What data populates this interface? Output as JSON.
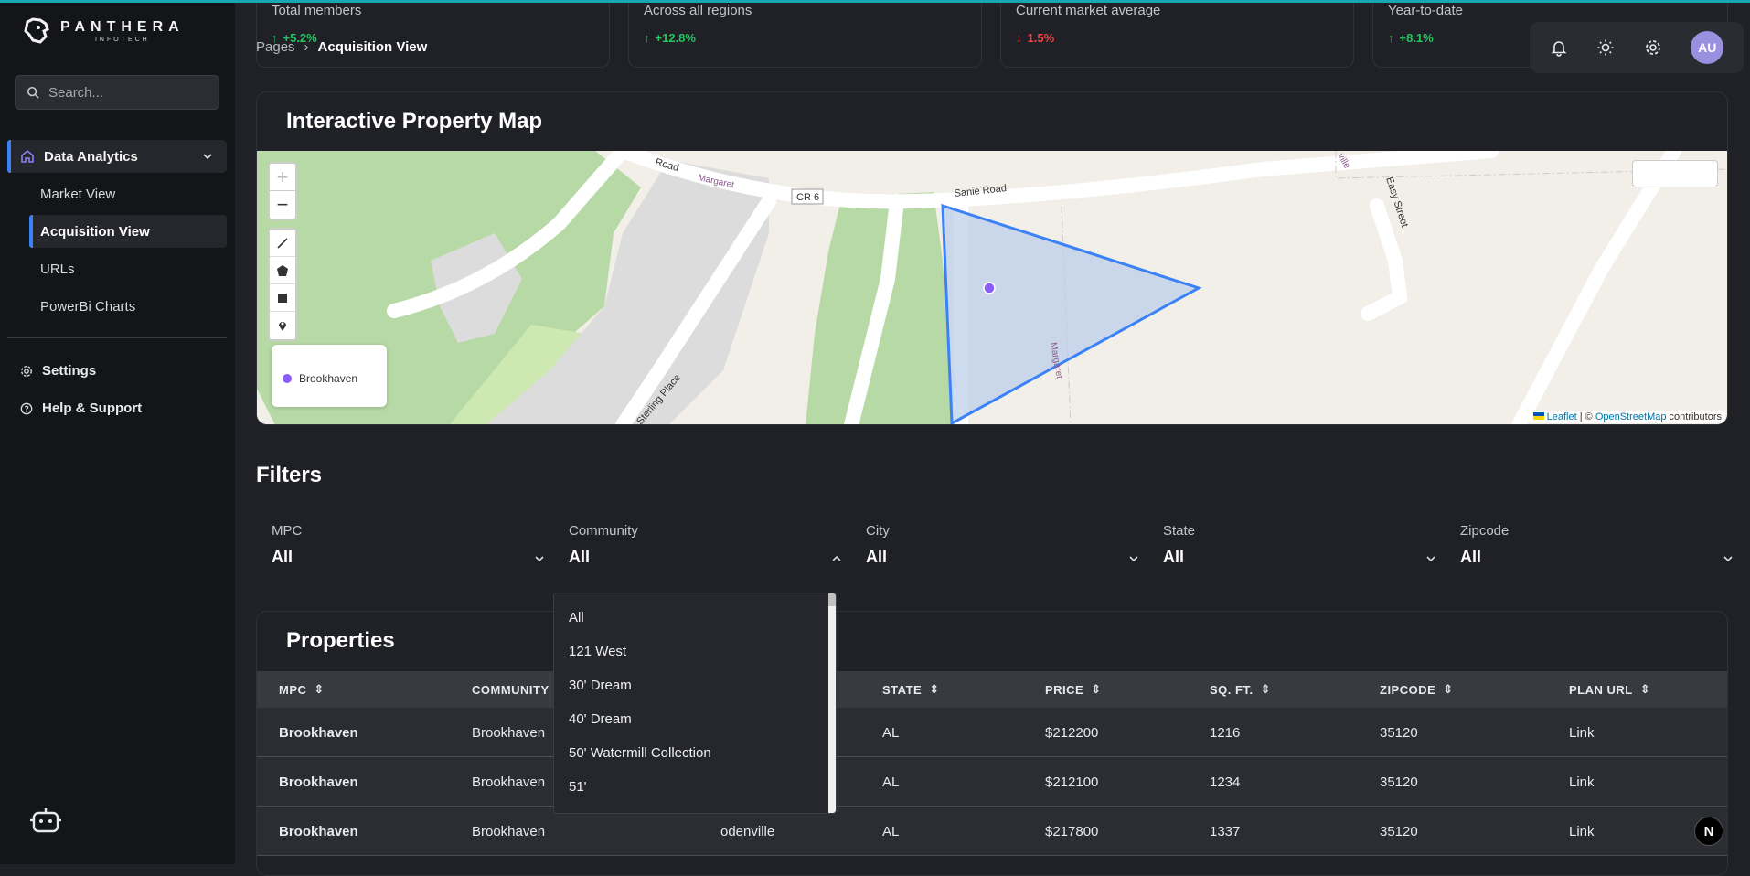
{
  "brand": {
    "name": "PANTHERA",
    "tagline": "INFOTECH"
  },
  "search": {
    "placeholder": "Search..."
  },
  "sidebar": {
    "group_label": "Data Analytics",
    "items": [
      {
        "label": "Market View"
      },
      {
        "label": "Acquisition View"
      },
      {
        "label": "URLs"
      },
      {
        "label": "PowerBi Charts"
      }
    ],
    "settings_label": "Settings",
    "help_label": "Help & Support"
  },
  "stats": [
    {
      "label": "Total members",
      "change": "+5.2%"
    },
    {
      "label": "Across all regions",
      "change": "+12.8%"
    },
    {
      "label": "Current market average",
      "change": "1.5%"
    },
    {
      "label": "Year-to-date",
      "change": "+8.1%"
    }
  ],
  "breadcrumb": {
    "root": "Pages",
    "current": "Acquisition View"
  },
  "header": {
    "avatar_initials": "AU"
  },
  "map": {
    "title": "Interactive Property Map",
    "zoom_in": "+",
    "zoom_out": "−",
    "legend_item": "Brookhaven",
    "labels": {
      "road1": "Road",
      "road2": "CR 6",
      "road3": "Sanie Road",
      "road4": "Easy Street",
      "road5": "Sterling Place",
      "road6": "Margaret",
      "road7": "Margaret",
      "road8": "ville"
    },
    "attribution": {
      "leaflet": "Leaflet",
      "sep": " | © ",
      "osm": "OpenStreetMap",
      "tail": " contributors"
    }
  },
  "filters": {
    "title": "Filters",
    "items": [
      {
        "label": "MPC",
        "value": "All"
      },
      {
        "label": "Community",
        "value": "All"
      },
      {
        "label": "City",
        "value": "All"
      },
      {
        "label": "State",
        "value": "All"
      },
      {
        "label": "Zipcode",
        "value": "All"
      }
    ],
    "community_options": [
      "All",
      "121 West",
      "30' Dream",
      "40' Dream",
      "50' Watermill Collection",
      "51'"
    ]
  },
  "properties": {
    "title": "Properties",
    "columns": [
      "MPC",
      "COMMUNITY",
      "STATE",
      "PRICE",
      "SQ. FT.",
      "ZIPCODE",
      "PLAN URL"
    ],
    "rows": [
      {
        "mpc": "Brookhaven",
        "community": "Brookhaven",
        "city": "",
        "state": "AL",
        "price": "$212200",
        "sqft": "1216",
        "zip": "35120",
        "url": "Link"
      },
      {
        "mpc": "Brookhaven",
        "community": "Brookhaven",
        "city": "",
        "state": "AL",
        "price": "$212100",
        "sqft": "1234",
        "zip": "35120",
        "url": "Link"
      },
      {
        "mpc": "Brookhaven",
        "community": "Brookhaven",
        "city": "odenville",
        "state": "AL",
        "price": "$217800",
        "sqft": "1337",
        "zip": "35120",
        "url": "Link"
      }
    ]
  },
  "corner_badge": "N",
  "colors": {
    "accent": "#3b82f6",
    "up": "#22c55e",
    "down": "#ef4444",
    "avatar": "#9b8fe0"
  }
}
